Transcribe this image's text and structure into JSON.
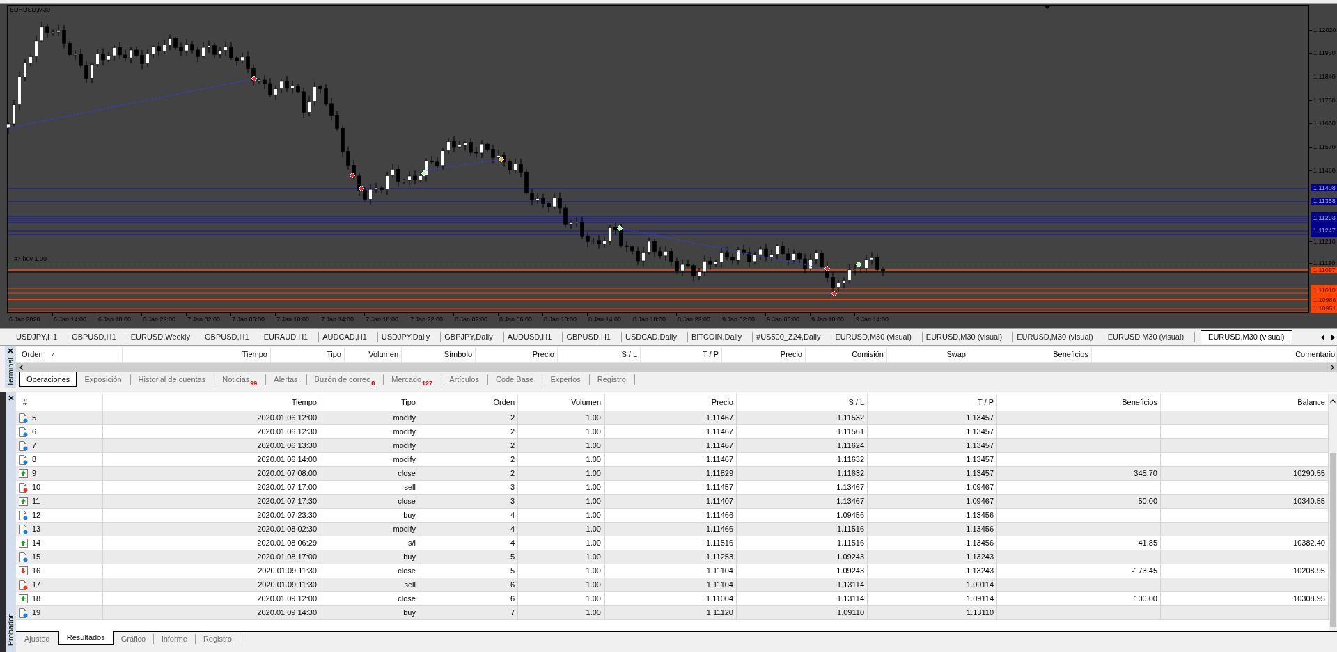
{
  "chart": {
    "symbol": "EURUSD,M30",
    "order_label": "#7 buy 1.00",
    "price_labels": [
      {
        "kind": "tick",
        "text": "1.12020"
      },
      {
        "kind": "tick",
        "text": "1.11930"
      },
      {
        "kind": "tick",
        "text": "1.11840"
      },
      {
        "kind": "tick",
        "text": "1.11750"
      },
      {
        "kind": "tick",
        "text": "1.11660"
      },
      {
        "kind": "tick",
        "text": "1.11570"
      },
      {
        "kind": "tick",
        "text": "1.11480"
      },
      {
        "kind": "level",
        "text": "1.11408",
        "color": "#00008b"
      },
      {
        "kind": "level",
        "text": "1.11358",
        "color": "#00008b"
      },
      {
        "kind": "level",
        "text": "1.11293",
        "color": "#00008b"
      },
      {
        "kind": "level",
        "text": "1.11247",
        "color": "#00008b"
      },
      {
        "kind": "tick",
        "text": "1.11210"
      },
      {
        "kind": "tick",
        "text": "1.11120"
      },
      {
        "kind": "level",
        "text": "1.11097",
        "color": "#ff4500"
      },
      {
        "kind": "level",
        "text": "1.11010",
        "color": "#ff4500"
      },
      {
        "kind": "level",
        "text": "1.10986",
        "color": "#ff4500"
      },
      {
        "kind": "level",
        "text": "1.10951",
        "color": "#ff4500"
      }
    ],
    "time_labels": [
      "6 Jan 2020",
      "6 Jan 14:00",
      "6 Jan 18:00",
      "6 Jan 22:00",
      "7 Jan 02:00",
      "7 Jan 06:00",
      "7 Jan 10:00",
      "7 Jan 14:00",
      "7 Jan 18:00",
      "7 Jan 22:00",
      "8 Jan 02:00",
      "8 Jan 06:00",
      "8 Jan 10:00",
      "8 Jan 14:00",
      "8 Jan 18:00",
      "8 Jan 22:00",
      "9 Jan 02:00",
      "9 Jan 06:00",
      "9 Jan 10:00",
      "9 Jan 14:00"
    ]
  },
  "chart_tabs": [
    {
      "label": "USDJPY,H1",
      "selected": false
    },
    {
      "label": "GBPUSD,H1",
      "selected": false
    },
    {
      "label": "EURUSD,Weekly",
      "selected": false
    },
    {
      "label": "GBPUSD,H1",
      "selected": false
    },
    {
      "label": "EURAUD,H1",
      "selected": false
    },
    {
      "label": "AUDCAD,H1",
      "selected": false
    },
    {
      "label": "USDJPY,Daily",
      "selected": false
    },
    {
      "label": "GBPJPY,Daily",
      "selected": false
    },
    {
      "label": "AUDUSD,H1",
      "selected": false
    },
    {
      "label": "GBPUSD,H1",
      "selected": false
    },
    {
      "label": "USDCAD,Daily",
      "selected": false
    },
    {
      "label": "BITCOIN,Daily",
      "selected": false
    },
    {
      "label": "#US500_Z24,Daily",
      "selected": false
    },
    {
      "label": "EURUSD,M30 (visual)",
      "selected": false
    },
    {
      "label": "EURUSD,M30 (visual)",
      "selected": false
    },
    {
      "label": "EURUSD,M30 (visual)",
      "selected": false
    },
    {
      "label": "EURUSD,M30 (visual)",
      "selected": false
    },
    {
      "label": "EURUSD,M30 (visual)",
      "selected": true
    }
  ],
  "terminal": {
    "title": "Terminal",
    "columns": [
      {
        "label": "Orden",
        "sorted": true
      },
      {
        "label": "Tiempo",
        "sorted": false
      },
      {
        "label": "Tipo",
        "sorted": false
      },
      {
        "label": "Volumen",
        "sorted": false
      },
      {
        "label": "Símbolo",
        "sorted": false
      },
      {
        "label": "Precio",
        "sorted": false
      },
      {
        "label": "S / L",
        "sorted": false
      },
      {
        "label": "T / P",
        "sorted": false
      },
      {
        "label": "Precio",
        "sorted": false
      },
      {
        "label": "Comisión",
        "sorted": false
      },
      {
        "label": "Swap",
        "sorted": false
      },
      {
        "label": "Beneficios",
        "sorted": false
      },
      {
        "label": "Comentario",
        "sorted": false
      }
    ],
    "tabs": [
      {
        "label": "Operaciones",
        "selected": true
      },
      {
        "label": "Exposición",
        "selected": false
      },
      {
        "label": "Historial de cuentas",
        "selected": false
      },
      {
        "label": "Noticias",
        "badge": "99",
        "selected": false
      },
      {
        "label": "Alertas",
        "selected": false
      },
      {
        "label": "Buzón de correo",
        "badge": "8",
        "selected": false
      },
      {
        "label": "Mercado",
        "badge": "127",
        "selected": false
      },
      {
        "label": "Artículos",
        "selected": false
      },
      {
        "label": "Code Base",
        "selected": false
      },
      {
        "label": "Expertos",
        "selected": false
      },
      {
        "label": "Registro",
        "selected": false
      }
    ]
  },
  "tester": {
    "title": "Probador",
    "columns": [
      "#",
      "Tiempo",
      "Tipo",
      "Orden",
      "Volumen",
      "Precio",
      "S / L",
      "T / P",
      "Beneficios",
      "Balance"
    ],
    "rows": [
      {
        "kind": "open",
        "number": "5",
        "time": "2020.01.06 12:00",
        "type": "modify",
        "order": "2",
        "volume": "1.00",
        "price": "1.11467",
        "sl": "1.11532",
        "tp": "1.13457"
      },
      {
        "kind": "open",
        "number": "6",
        "time": "2020.01.06 12:30",
        "type": "modify",
        "order": "2",
        "volume": "1.00",
        "price": "1.11467",
        "sl": "1.11561",
        "tp": "1.13457"
      },
      {
        "kind": "open",
        "number": "7",
        "time": "2020.01.06 13:30",
        "type": "modify",
        "order": "2",
        "volume": "1.00",
        "price": "1.11467",
        "sl": "1.11624",
        "tp": "1.13457"
      },
      {
        "kind": "open",
        "number": "8",
        "time": "2020.01.06 14:00",
        "type": "modify",
        "order": "2",
        "volume": "1.00",
        "price": "1.11467",
        "sl": "1.11632",
        "tp": "1.13457"
      },
      {
        "kind": "gain",
        "number": "9",
        "time": "2020.01.07 08:00",
        "type": "close",
        "order": "2",
        "volume": "1.00",
        "price": "1.11829",
        "sl": "1.11632",
        "tp": "1.13457",
        "profit": "345.70",
        "balance": "10290.55"
      },
      {
        "kind": "sell",
        "number": "10",
        "time": "2020.01.07 17:00",
        "type": "sell",
        "order": "3",
        "volume": "1.00",
        "price": "1.11457",
        "sl": "1.13467",
        "tp": "1.09467"
      },
      {
        "kind": "gain",
        "number": "11",
        "time": "2020.01.07 17:30",
        "type": "close",
        "order": "3",
        "volume": "1.00",
        "price": "1.11407",
        "sl": "1.13467",
        "tp": "1.09467",
        "profit": "50.00",
        "balance": "10340.55"
      },
      {
        "kind": "open",
        "number": "12",
        "time": "2020.01.07 23:30",
        "type": "buy",
        "order": "4",
        "volume": "1.00",
        "price": "1.11466",
        "sl": "1.09456",
        "tp": "1.13456"
      },
      {
        "kind": "open",
        "number": "13",
        "time": "2020.01.08 02:30",
        "type": "modify",
        "order": "4",
        "volume": "1.00",
        "price": "1.11466",
        "sl": "1.11516",
        "tp": "1.13456"
      },
      {
        "kind": "gain",
        "number": "14",
        "time": "2020.01.08 06:29",
        "type": "s/l",
        "order": "4",
        "volume": "1.00",
        "price": "1.11516",
        "sl": "1.11516",
        "tp": "1.13456",
        "profit": "41.85",
        "balance": "10382.40"
      },
      {
        "kind": "open",
        "number": "15",
        "time": "2020.01.08 17:00",
        "type": "buy",
        "order": "5",
        "volume": "1.00",
        "price": "1.11253",
        "sl": "1.09243",
        "tp": "1.13243"
      },
      {
        "kind": "loss",
        "number": "16",
        "time": "2020.01.09 11:30",
        "type": "close",
        "order": "5",
        "volume": "1.00",
        "price": "1.11104",
        "sl": "1.09243",
        "tp": "1.13243",
        "profit": "-173.45",
        "balance": "10208.95"
      },
      {
        "kind": "sell",
        "number": "17",
        "time": "2020.01.09 11:30",
        "type": "sell",
        "order": "6",
        "volume": "1.00",
        "price": "1.11104",
        "sl": "1.13114",
        "tp": "1.09114"
      },
      {
        "kind": "gain",
        "number": "18",
        "time": "2020.01.09 12:00",
        "type": "close",
        "order": "6",
        "volume": "1.00",
        "price": "1.11004",
        "sl": "1.13114",
        "tp": "1.09114",
        "profit": "100.00",
        "balance": "10308.95"
      },
      {
        "kind": "open",
        "number": "19",
        "time": "2020.01.09 14:30",
        "type": "buy",
        "order": "7",
        "volume": "1.00",
        "price": "1.11120",
        "sl": "1.09110",
        "tp": "1.13110"
      }
    ],
    "tabs": [
      {
        "label": "Ajusted",
        "selected": false
      },
      {
        "label": "Resultados",
        "selected": true
      },
      {
        "label": "Gráfico",
        "selected": false
      },
      {
        "label": "informe",
        "selected": false
      },
      {
        "label": "Registro",
        "selected": false
      }
    ]
  }
}
